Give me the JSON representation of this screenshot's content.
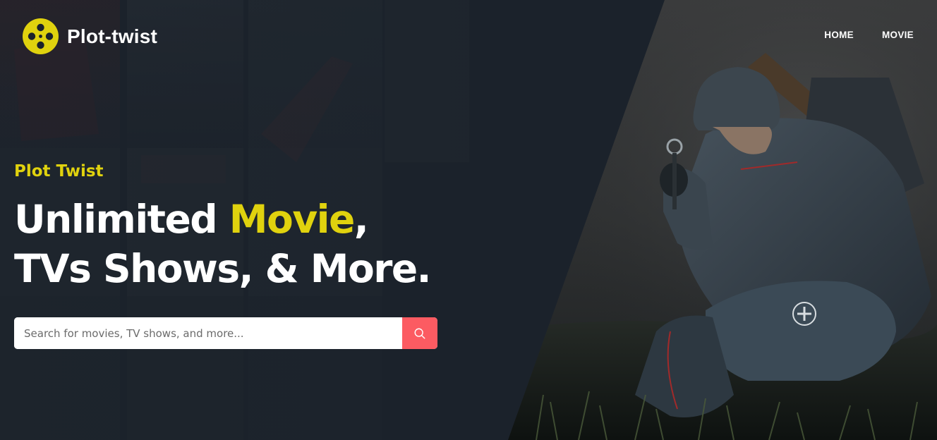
{
  "header": {
    "brand": "Plot-twist",
    "nav": [
      {
        "label": "HOME"
      },
      {
        "label": "MOVIE"
      }
    ]
  },
  "hero": {
    "eyebrow": "Plot Twist",
    "headline": {
      "part1": "Unlimited ",
      "accent": "Movie",
      "part2": ",",
      "line2": "TVs Shows, & More."
    },
    "search": {
      "placeholder": "Search for movies, TV shows, and more..."
    }
  },
  "colors": {
    "accent_yellow": "#e0d20e",
    "search_button": "#fc5b62",
    "background": "#1b222b"
  },
  "icons": {
    "logo": "film-reel-icon",
    "search": "magnifier-icon"
  }
}
